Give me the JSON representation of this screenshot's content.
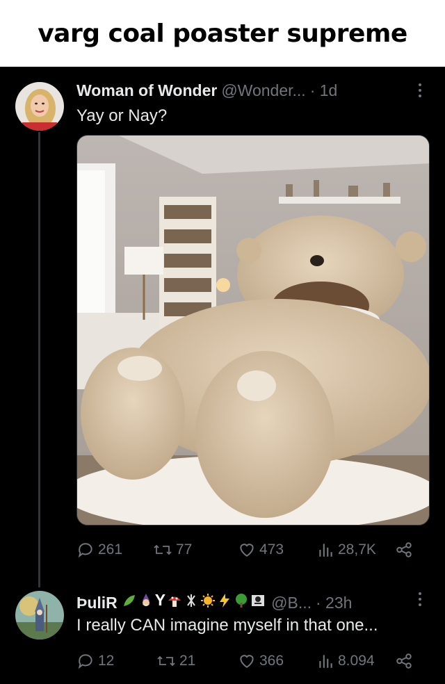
{
  "meme": {
    "caption": "varg coal poaster supreme"
  },
  "tweet": {
    "author": "Woman of Wonder",
    "handle": "@Wonder...",
    "time": "· 1d",
    "text": "Yay or Nay?",
    "stats": {
      "replies": "261",
      "retweets": "77",
      "likes": "473",
      "views": "28,7K"
    },
    "media_icon": "giant-teddy-bear-bed-photo"
  },
  "reply": {
    "author": "ÞuliR",
    "author_emoji": [
      "leaf",
      "wizard",
      "Y",
      "mushroom",
      "norse-symbol",
      "sun",
      "lightning",
      "tree",
      "skull-flag"
    ],
    "handle": "@B...",
    "time": "· 23h",
    "text": "I really CAN imagine myself in that one...",
    "stats": {
      "replies": "12",
      "retweets": "21",
      "likes": "366",
      "views": "8.094"
    }
  },
  "colors": {
    "muted": "#71767b",
    "text": "#e7e9ea",
    "line": "#333639"
  }
}
